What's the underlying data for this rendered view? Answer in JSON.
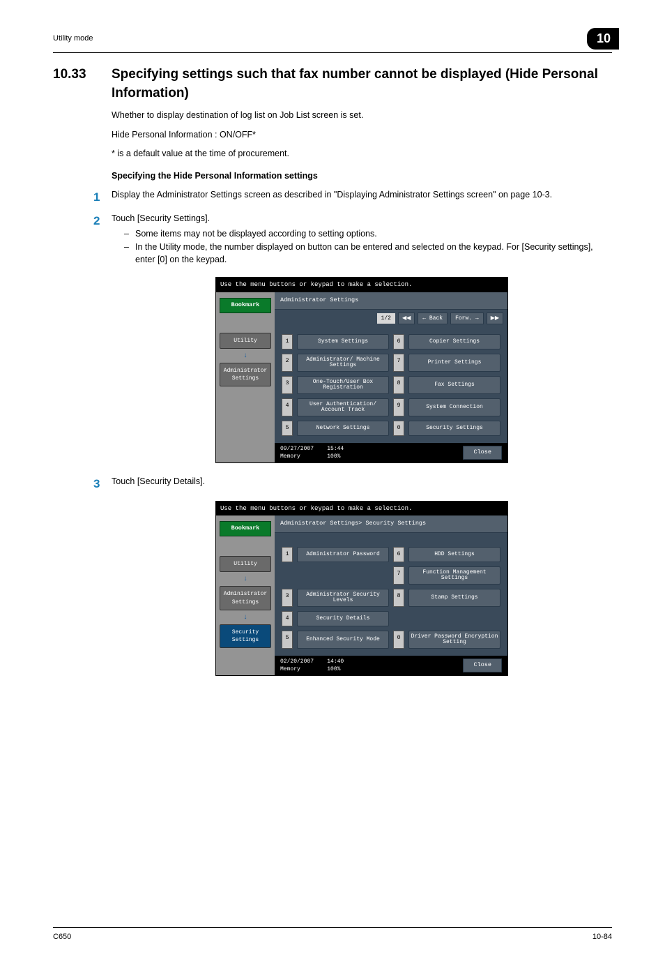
{
  "header": {
    "breadcrumb": "Utility mode",
    "chapter": "10"
  },
  "section": {
    "number": "10.33",
    "title": "Specifying settings such that fax number cannot be displayed (Hide Personal Information)"
  },
  "intro": {
    "p1": "Whether to display destination of log list on Job List screen is set.",
    "p2": "Hide Personal Information : ON/OFF*",
    "p3": "* is a default value at the time of procurement."
  },
  "subheading": "Specifying the Hide Personal Information settings",
  "steps": {
    "s1": "Display the Administrator Settings screen as described in \"Displaying Administrator Settings screen\" on page 10-3.",
    "s2": "Touch [Security Settings].",
    "s2_sub1": "Some items may not be displayed according to setting options.",
    "s2_sub2": "In the Utility mode, the number displayed on button can be entered and selected on the keypad. For [Security settings], enter [0] on the keypad.",
    "s3": "Touch [Security Details]."
  },
  "screen1": {
    "topmsg": "Use the menu buttons or keypad to make a selection.",
    "bookmark": "Bookmark",
    "sidebar": {
      "utility": "Utility",
      "admin": "Administrator Settings"
    },
    "crumb": "Administrator Settings",
    "pager": "1/2",
    "back": "Back",
    "forward": "Forw.",
    "items": {
      "i1": "System Settings",
      "i2": "Administrator/\nMachine Settings",
      "i3": "One-Touch/User Box\nRegistration",
      "i4": "User Authentication/\nAccount Track",
      "i5": "Network Settings",
      "i6": "Copier Settings",
      "i7": "Printer Settings",
      "i8": "Fax Settings",
      "i9": "System Connection",
      "i0": "Security Settings"
    },
    "footer": {
      "date": "09/27/2007",
      "time": "15:44",
      "mem": "Memory",
      "mval": "100%",
      "close": "Close"
    }
  },
  "screen2": {
    "topmsg": "Use the menu buttons or keypad to make a selection.",
    "bookmark": "Bookmark",
    "sidebar": {
      "utility": "Utility",
      "admin": "Administrator Settings",
      "security": "Security Settings"
    },
    "crumb": "Administrator Settings> Security Settings",
    "items": {
      "i1": "Administrator Password",
      "i3": "Administrator Security\nLevels",
      "i4": "Security Details",
      "i5": "Enhanced Security Mode",
      "i6": "HDD Settings",
      "i7": "Function Management Settings",
      "i8": "Stamp Settings",
      "i0": "Driver Password\nEncryption Setting"
    },
    "footer": {
      "date": "02/20/2007",
      "time": "14:40",
      "mem": "Memory",
      "mval": "100%",
      "close": "Close"
    }
  },
  "pagefooter": {
    "left": "C650",
    "right": "10-84"
  }
}
